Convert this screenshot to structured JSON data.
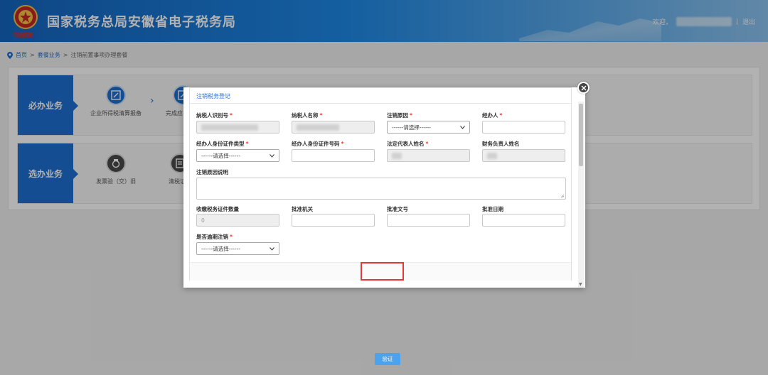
{
  "header": {
    "title": "国家税务总局安徽省电子税务局",
    "emblem_script": "中国税务",
    "welcome": "欢迎，",
    "separator": "|",
    "logout": "退出"
  },
  "breadcrumb": {
    "home": "首页",
    "sep": ">",
    "category": "套餐业务",
    "current": "注销前置事项办理套餐"
  },
  "rows": {
    "required": {
      "tag": "必办业务",
      "items": [
        {
          "label": "企业所得税清算报备"
        },
        {
          "label": "完成应申报款"
        }
      ]
    },
    "optional": {
      "tag": "选办业务",
      "items": [
        {
          "label": "发票验（交）旧"
        },
        {
          "label": "清税证明"
        }
      ]
    }
  },
  "modal": {
    "title": "注销税务登记",
    "fields": {
      "taxpayer_id": {
        "label": "纳税人识别号",
        "required": "*"
      },
      "taxpayer_name": {
        "label": "纳税人名称",
        "required": "*"
      },
      "cancel_reason": {
        "label": "注销原因",
        "required": "*",
        "selected": "------请选择------"
      },
      "handler": {
        "label": "经办人",
        "required": "*",
        "value": ""
      },
      "handler_id_type": {
        "label": "经办人身份证件类型",
        "required": "*",
        "selected": "------请选择------"
      },
      "handler_id_number": {
        "label": "经办人身份证件号码",
        "required": "*",
        "value": ""
      },
      "legal_rep_name": {
        "label": "法定代表人姓名",
        "required": "*"
      },
      "finance_head_name": {
        "label": "财务负责人姓名"
      },
      "reason_desc": {
        "label": "注销原因说明",
        "value": ""
      },
      "cert_count": {
        "label": "收缴税务证件数量",
        "value": "0"
      },
      "approval_org": {
        "label": "批准机关",
        "value": ""
      },
      "approval_doc": {
        "label": "批准文号",
        "value": ""
      },
      "approval_date": {
        "label": "批准日期",
        "value": ""
      },
      "overdue_cancel": {
        "label": "是否逾期注销",
        "required": "*",
        "selected": "------请选择------"
      }
    },
    "verify_button": "验证"
  },
  "colors": {
    "header_blue": "#1565c0",
    "accent": "#1e6fd1",
    "button": "#4aa3ee",
    "highlight": "#e53935"
  }
}
